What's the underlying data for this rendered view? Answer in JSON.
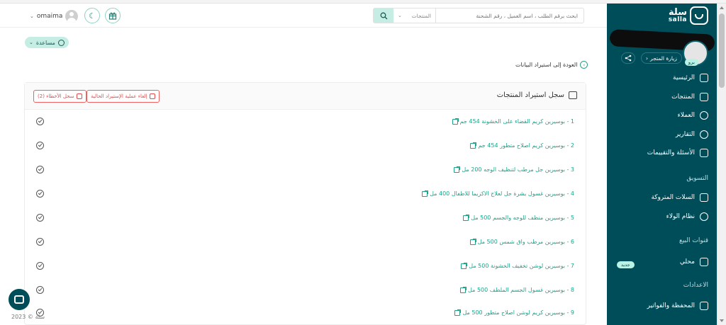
{
  "colors": {
    "sidebar_bg": "#004d5a",
    "accent": "#1aa58a",
    "accent_light": "#c5ede4",
    "danger": "#e14b4b"
  },
  "brand": {
    "name_ar": "سلة",
    "name_en": "salla"
  },
  "store": {
    "plan_badge": "برو",
    "visit_label": "زيارة المتجر"
  },
  "sidebar": {
    "items_top": [
      {
        "label": "الرئيسية",
        "icon": "home-icon"
      },
      {
        "label": "المنتجات",
        "icon": "shirt-icon"
      },
      {
        "label": "العملاء",
        "icon": "users-icon"
      },
      {
        "label": "التقارير",
        "icon": "pie-chart-icon"
      },
      {
        "label": "الأسئلة والتقييمات",
        "icon": "comment-icon"
      }
    ],
    "section_marketing": "التسويق",
    "items_marketing": [
      {
        "label": "السلات المتروكة",
        "icon": "cart-icon"
      },
      {
        "label": "نظام الولاء",
        "icon": "user-star-icon"
      }
    ],
    "section_sales": "قنوات البيع",
    "local_label": "محلي",
    "new_badge": "جديد",
    "section_settings": "الاعدادات",
    "wallet_label": "المحفظة والفواتير"
  },
  "header": {
    "username": "omaima",
    "search_placeholder": "ابحث برقم الطلب ، اسم العميل ، رقم الشحنة",
    "search_scope": "المنتجات"
  },
  "content": {
    "help_label": "مساعدة",
    "back_label": "العودة إلى استيراد البيانات",
    "card_title": "سجل استيراد المنتجات",
    "cancel_import_label": "إلغاء عملية الإستيراد الحالية",
    "error_log_label": "سجل الأخطاء (2)",
    "rows": [
      "1 - بوسيرين كريم القضاء على الخشونة 454 جم",
      "2 - بوسيرين كريم اصلاح متطور 454 جم",
      "3 - بوسيرين جل مرطب لتنظيف الوجه 200 مل",
      "4 - بوسيرين غسول بشرة جل لعلاج الاكزيما للاطفال 400 مل",
      "5 - بوسيرين منظف للوجه والجسم 500 مل",
      "6 - بوسيرين مرطب واق شمس 500 مل",
      "7 - بوسيرين لوشن تخفيف الخشونة 500 مل",
      "8 - بوسيرين غسول الجسم الملطف 500 مل",
      "9 - بوسيرين كريم لوشن اصلاح متطور 500 مل"
    ]
  },
  "footer": {
    "copyright": "سلة © 2023"
  }
}
